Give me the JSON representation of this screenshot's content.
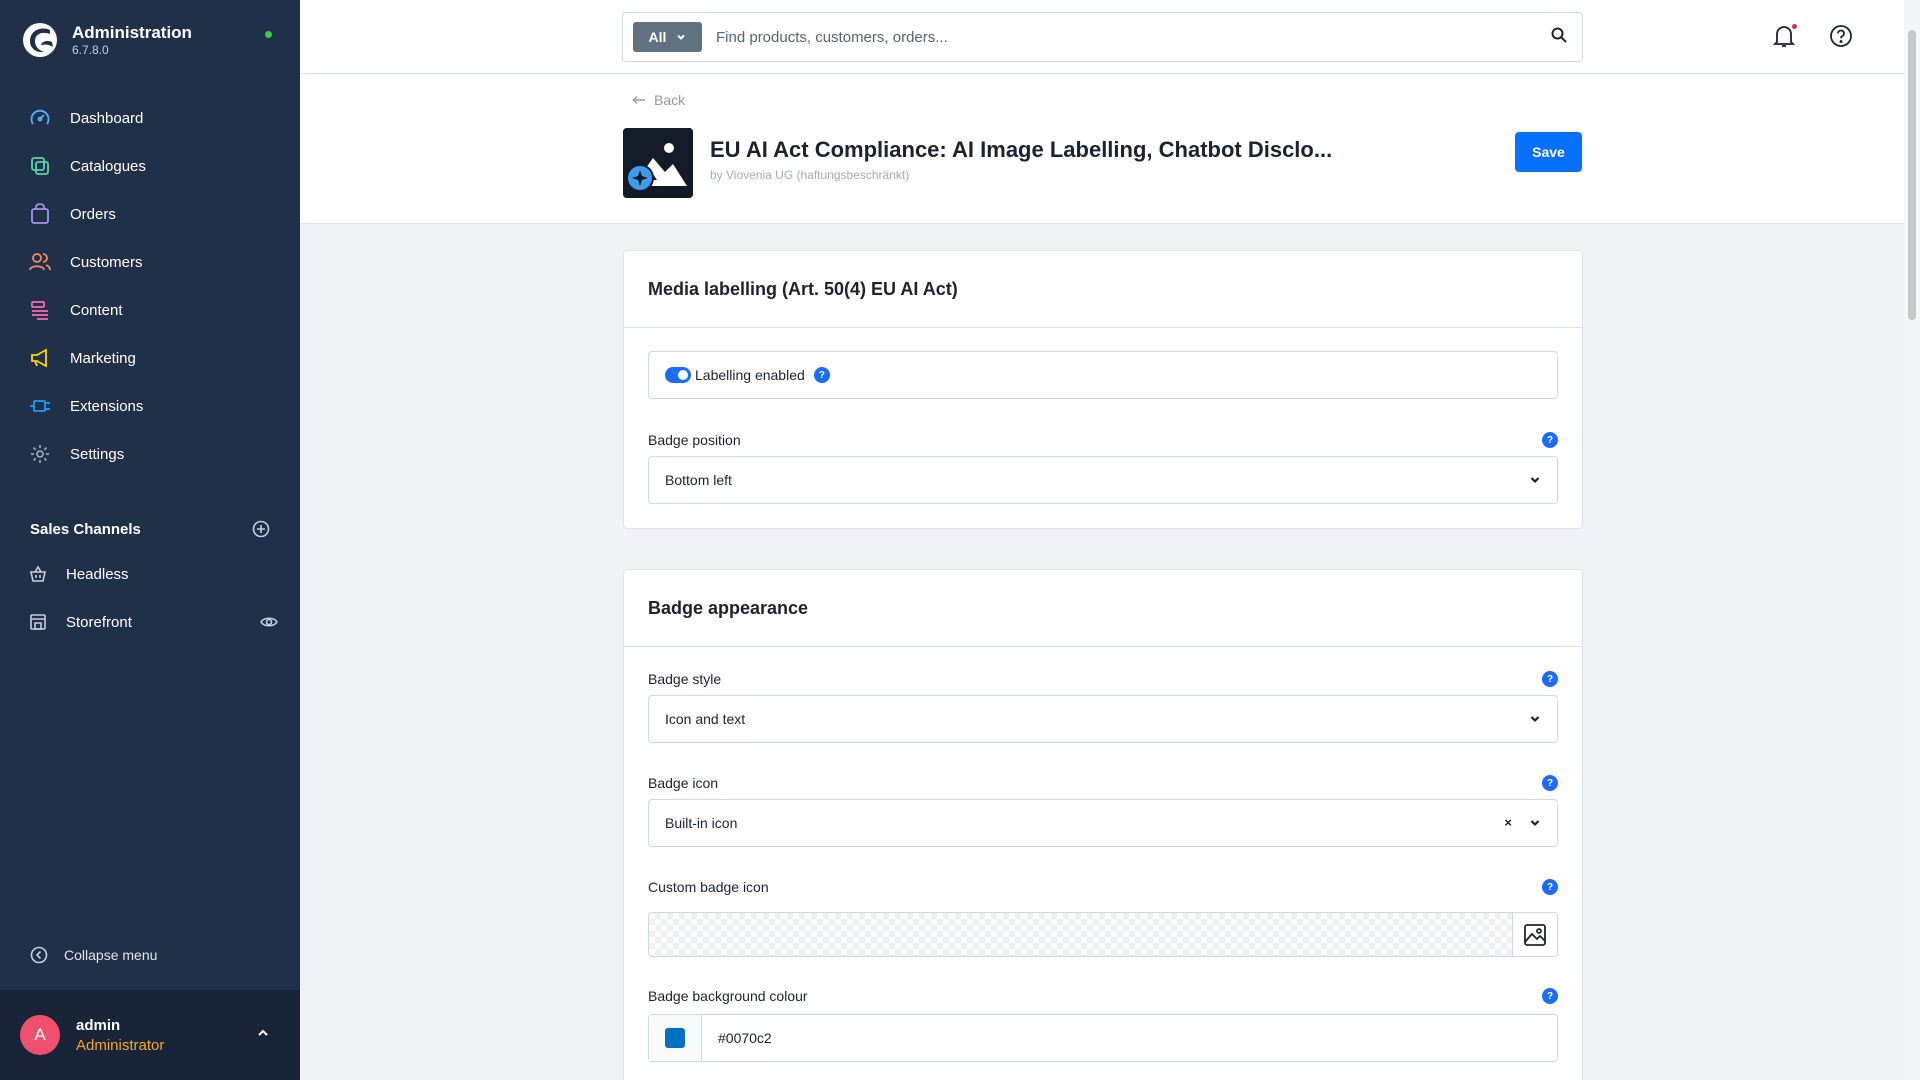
{
  "app": {
    "title": "Administration",
    "version": "6.7.8.0"
  },
  "sidebar": {
    "nav": [
      {
        "label": "Dashboard",
        "icon": "dashboard-icon",
        "color": "#52b1ff"
      },
      {
        "label": "Catalogues",
        "icon": "catalogue-icon",
        "color": "#57d9a3"
      },
      {
        "label": "Orders",
        "icon": "orders-icon",
        "color": "#a092f0"
      },
      {
        "label": "Customers",
        "icon": "customers-icon",
        "color": "#f88962"
      },
      {
        "label": "Content",
        "icon": "content-icon",
        "color": "#ff68b4"
      },
      {
        "label": "Marketing",
        "icon": "marketing-icon",
        "color": "#ffd700"
      },
      {
        "label": "Extensions",
        "icon": "extensions-icon",
        "color": "#189eff"
      },
      {
        "label": "Settings",
        "icon": "settings-icon",
        "color": "#9aa8b5"
      }
    ],
    "sales_channels": {
      "title": "Sales Channels",
      "items": [
        {
          "label": "Headless",
          "icon": "basket-icon"
        },
        {
          "label": "Storefront",
          "icon": "storefront-icon"
        }
      ]
    },
    "collapse_label": "Collapse menu",
    "user": {
      "initial": "A",
      "name": "admin",
      "role": "Administrator"
    }
  },
  "search": {
    "type_label": "All",
    "placeholder": "Find products, customers, orders..."
  },
  "header": {
    "back_label": "Back",
    "extension_title": "EU AI Act Compliance: AI Image Labelling, Chatbot Disclo...",
    "author": "by Viovenia UG (haftungsbeschränkt)",
    "save_label": "Save"
  },
  "cards": {
    "media": {
      "title": "Media labelling (Art. 50(4) EU AI Act)",
      "toggle_label": "Labelling enabled",
      "toggle_on": true,
      "badge_position_label": "Badge position",
      "badge_position_value": "Bottom left"
    },
    "appearance": {
      "title": "Badge appearance",
      "badge_style_label": "Badge style",
      "badge_style_value": "Icon and text",
      "badge_icon_label": "Badge icon",
      "badge_icon_value": "Built-in icon",
      "custom_icon_label": "Custom badge icon",
      "bg_colour_label": "Badge background colour",
      "bg_colour_value": "#0070c2"
    }
  },
  "help_glyph": "?",
  "clear_glyph": "×"
}
